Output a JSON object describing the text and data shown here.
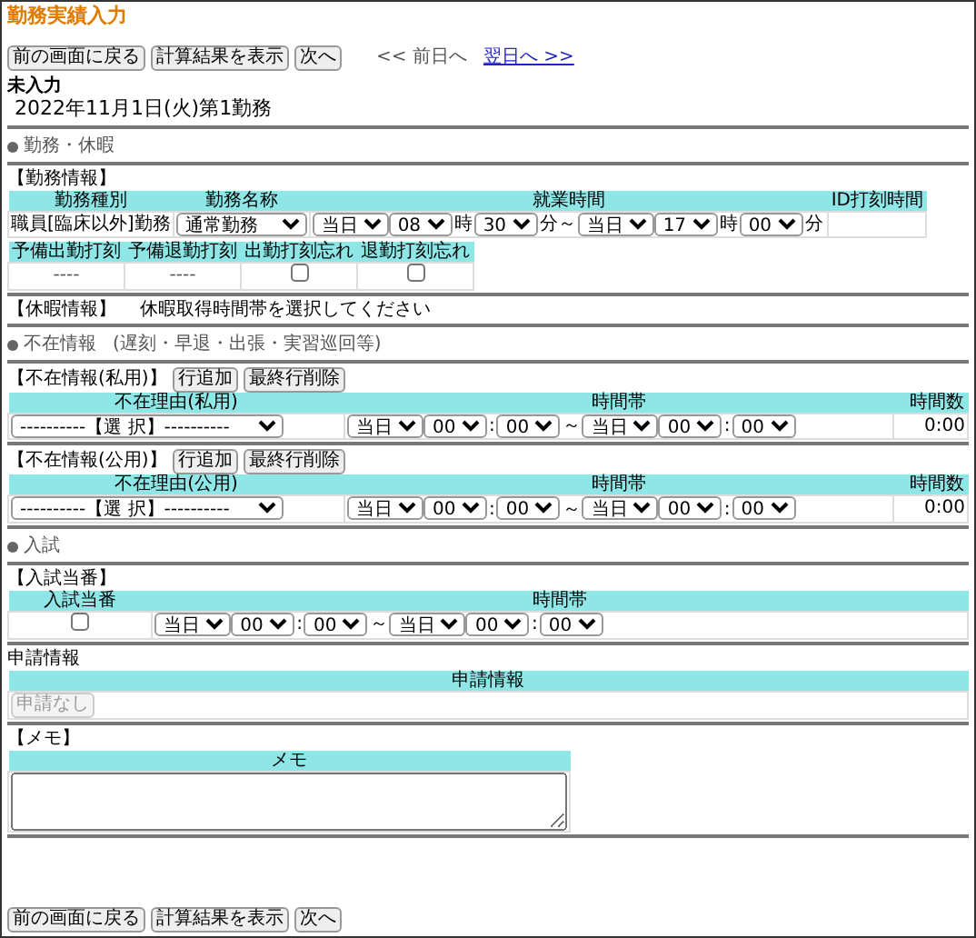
{
  "page_title": "勤務実績入力",
  "top_buttons": [
    "前の画面に戻る",
    "計算結果を表示",
    "次へ"
  ],
  "day_nav": [
    {
      "label": "<< 前日へ",
      "disabled": true
    },
    {
      "label": "翌日へ >>",
      "disabled": false
    }
  ],
  "status": "未入力",
  "date_heading": "2022年11月1日(火)第1勤務",
  "work_heading": "勤務・休暇",
  "work_info": {
    "label": "【勤務情報】",
    "columns": [
      "勤務種別",
      "勤務名称",
      "就業時間",
      "ID打刻時間"
    ],
    "type": "職員[臨床以外]勤務",
    "name": "通常勤務",
    "time": [
      {
        "kind": "select",
        "value": "当日"
      },
      {
        "kind": "select",
        "value": "08"
      },
      {
        "kind": "text",
        "value": "時"
      },
      {
        "kind": "select",
        "value": "30"
      },
      {
        "kind": "text",
        "value": "分～"
      },
      {
        "kind": "select",
        "value": "当日"
      },
      {
        "kind": "select",
        "value": "17"
      },
      {
        "kind": "text",
        "value": "時"
      },
      {
        "kind": "select",
        "value": "00"
      },
      {
        "kind": "text",
        "value": "分"
      }
    ]
  },
  "stamp_table": {
    "columns": [
      "予備出勤打刻",
      "予備退勤打刻",
      "出勤打刻忘れ",
      "退勤打刻忘れ"
    ],
    "cells": [
      {
        "kind": "text",
        "value": "----"
      },
      {
        "kind": "text",
        "value": "----"
      },
      {
        "kind": "checkbox",
        "checked": false
      },
      {
        "kind": "checkbox",
        "checked": false
      }
    ]
  },
  "leave_info": {
    "label": "【休暇情報】",
    "message": "休暇取得時間帯を選択してください"
  },
  "absence_heading": "不在情報",
  "absence_note": "(遅刻・早退・出張・実習巡回等)",
  "absence_tables": [
    {
      "label": "【不在情報(私用)】",
      "buttons": [
        "行追加",
        "最終行削除"
      ],
      "columns": [
        "不在理由(私用)",
        "時間帯",
        "時間数"
      ],
      "reason": "----------【選 択】----------",
      "time": [
        {
          "kind": "select",
          "value": "当日"
        },
        {
          "kind": "select",
          "value": "00"
        },
        {
          "kind": "text",
          "value": ":"
        },
        {
          "kind": "select",
          "value": "00"
        },
        {
          "kind": "text",
          "value": "～"
        },
        {
          "kind": "select",
          "value": "当日"
        },
        {
          "kind": "select",
          "value": "00"
        },
        {
          "kind": "text",
          "value": ":"
        },
        {
          "kind": "select",
          "value": "00"
        }
      ],
      "hours": "0:00"
    },
    {
      "label": "【不在情報(公用)】",
      "buttons": [
        "行追加",
        "最終行削除"
      ],
      "columns": [
        "不在理由(公用)",
        "時間帯",
        "時間数"
      ],
      "reason": "----------【選 択】----------",
      "time": [
        {
          "kind": "select",
          "value": "当日"
        },
        {
          "kind": "select",
          "value": "00"
        },
        {
          "kind": "text",
          "value": ":"
        },
        {
          "kind": "select",
          "value": "00"
        },
        {
          "kind": "text",
          "value": "～"
        },
        {
          "kind": "select",
          "value": "当日"
        },
        {
          "kind": "select",
          "value": "00"
        },
        {
          "kind": "text",
          "value": ":"
        },
        {
          "kind": "select",
          "value": "00"
        }
      ],
      "hours": "0:00"
    }
  ],
  "exam_heading": "入試",
  "exam_duty": {
    "label": "【入試当番】",
    "columns": [
      "入試当番",
      "時間帯"
    ],
    "checked": false,
    "time": [
      {
        "kind": "select",
        "value": "当日"
      },
      {
        "kind": "select",
        "value": "00"
      },
      {
        "kind": "text",
        "value": ":"
      },
      {
        "kind": "select",
        "value": "00"
      },
      {
        "kind": "text",
        "value": "～"
      },
      {
        "kind": "select",
        "value": "当日"
      },
      {
        "kind": "select",
        "value": "00"
      },
      {
        "kind": "text",
        "value": ":"
      },
      {
        "kind": "select",
        "value": "00"
      }
    ]
  },
  "application": {
    "label": "申請情報",
    "column": "申請情報",
    "button": {
      "label": "申請なし",
      "disabled": true
    }
  },
  "memo": {
    "label": "【メモ】",
    "column": "メモ"
  },
  "bottom_buttons": [
    "前の画面に戻る",
    "計算結果を表示",
    "次へ"
  ]
}
